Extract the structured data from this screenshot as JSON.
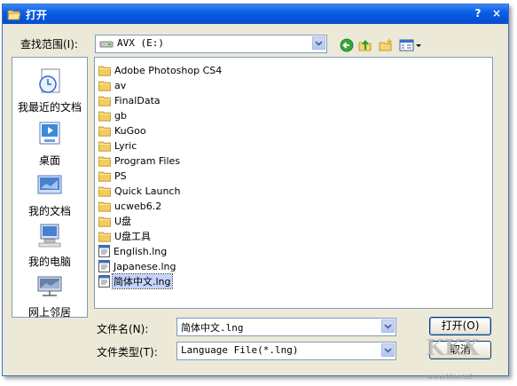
{
  "window": {
    "title": "打开",
    "help_label": "?",
    "close_label": "×"
  },
  "lookin": {
    "label": "查找范围(I):",
    "value": "AVX (E:)"
  },
  "places": [
    {
      "label": "我最近的文档",
      "icon": "recent-docs-icon"
    },
    {
      "label": "桌面",
      "icon": "desktop-icon"
    },
    {
      "label": "我的文档",
      "icon": "my-documents-icon"
    },
    {
      "label": "我的电脑",
      "icon": "my-computer-icon"
    },
    {
      "label": "网上邻居",
      "icon": "network-icon"
    }
  ],
  "files": [
    {
      "name": "Adobe Photoshop CS4",
      "type": "folder"
    },
    {
      "name": "av",
      "type": "folder"
    },
    {
      "name": "FinalData",
      "type": "folder"
    },
    {
      "name": "gb",
      "type": "folder"
    },
    {
      "name": "KuGoo",
      "type": "folder"
    },
    {
      "name": "Lyric",
      "type": "folder"
    },
    {
      "name": "Program Files",
      "type": "folder"
    },
    {
      "name": "PS",
      "type": "folder"
    },
    {
      "name": "Quick Launch",
      "type": "folder"
    },
    {
      "name": "ucweb6.2",
      "type": "folder"
    },
    {
      "name": "U盘",
      "type": "folder"
    },
    {
      "name": "U盘工具",
      "type": "folder"
    },
    {
      "name": "English.lng",
      "type": "file"
    },
    {
      "name": "Japanese.lng",
      "type": "file"
    },
    {
      "name": "简体中文.lng",
      "type": "file",
      "selected": true
    }
  ],
  "filename": {
    "label": "文件名(N):",
    "value": "简体中文.lng"
  },
  "filetype": {
    "label": "文件类型(T):",
    "value": "Language File(*.lng)"
  },
  "buttons": {
    "open": "打开(O)",
    "cancel": "取消"
  },
  "watermark": {
    "text": "KKX",
    "sub": "www.kkx.net"
  },
  "colors": {
    "titlebar": "#0a5ee6",
    "dialog_bg": "#ece9d8",
    "selection": "#c3d3fd"
  }
}
